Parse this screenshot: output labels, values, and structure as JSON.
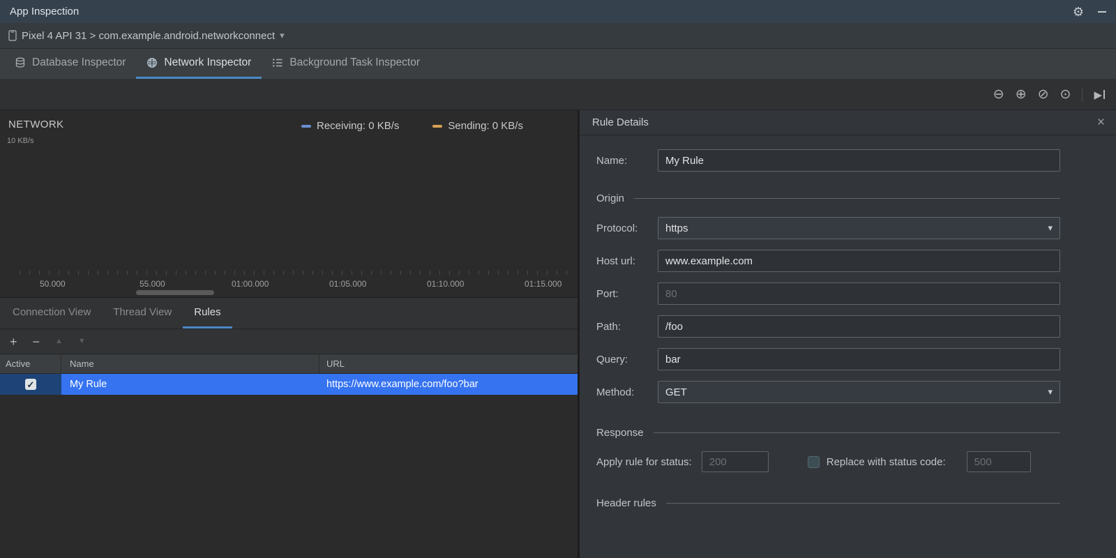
{
  "titlebar": {
    "title": "App Inspection"
  },
  "devicebar": {
    "selector": "Pixel 4 API 31 > com.example.android.networkconnect"
  },
  "inspector_tabs": [
    {
      "label": "Database Inspector",
      "active": false
    },
    {
      "label": "Network Inspector",
      "active": true
    },
    {
      "label": "Background Task Inspector",
      "active": false
    }
  ],
  "timeline": {
    "network_label": "NETWORK",
    "y_axis_label": "10 KB/s",
    "legend": [
      {
        "label": "Receiving: 0 KB/s",
        "color": "#6c8fd4"
      },
      {
        "label": "Sending: 0 KB/s",
        "color": "#d9a054"
      }
    ],
    "ticks": [
      "50.000",
      "55.000",
      "01:00.000",
      "01:05.000",
      "01:10.000",
      "01:15.000"
    ]
  },
  "left_tabs": [
    {
      "label": "Connection View",
      "active": false
    },
    {
      "label": "Thread View",
      "active": false
    },
    {
      "label": "Rules",
      "active": true
    }
  ],
  "rules_table": {
    "columns": [
      "Active",
      "Name",
      "URL"
    ],
    "rows": [
      {
        "active": true,
        "name": "My Rule",
        "url": "https://www.example.com/foo?bar"
      }
    ]
  },
  "rule_details": {
    "title": "Rule Details",
    "name_label": "Name:",
    "name_value": "My Rule",
    "origin_section": "Origin",
    "form_rows": [
      {
        "label": "Protocol:",
        "value": "https",
        "type": "select"
      },
      {
        "label": "Host url:",
        "value": "www.example.com",
        "type": "text"
      },
      {
        "label": "Port:",
        "placeholder": "80",
        "type": "text"
      },
      {
        "label": "Path:",
        "value": "/foo",
        "type": "text"
      },
      {
        "label": "Query:",
        "value": "bar",
        "type": "text"
      },
      {
        "label": "Method:",
        "value": "GET",
        "type": "select"
      }
    ],
    "response_section": "Response",
    "apply_label": "Apply rule for status:",
    "apply_placeholder": "200",
    "replace_label": "Replace with status code:",
    "replace_placeholder": "500",
    "replace_checked": false,
    "header_rules_section": "Header rules"
  },
  "colors": {
    "accent_underline": "#4a88c7",
    "selected_row": "#3573f0",
    "receiving": "#6c8fd4",
    "sending": "#d9a054"
  },
  "icons": {
    "gear": "⚙",
    "chevron_down": "▾",
    "zoom_out": "⊖",
    "zoom_in": "⊕",
    "reset_zoom": "⊘",
    "zoom_selection": "⊙",
    "go_live": "▶",
    "close": "×",
    "add": "+",
    "remove": "−",
    "up": "▲",
    "down": "▼",
    "check": "✓"
  }
}
